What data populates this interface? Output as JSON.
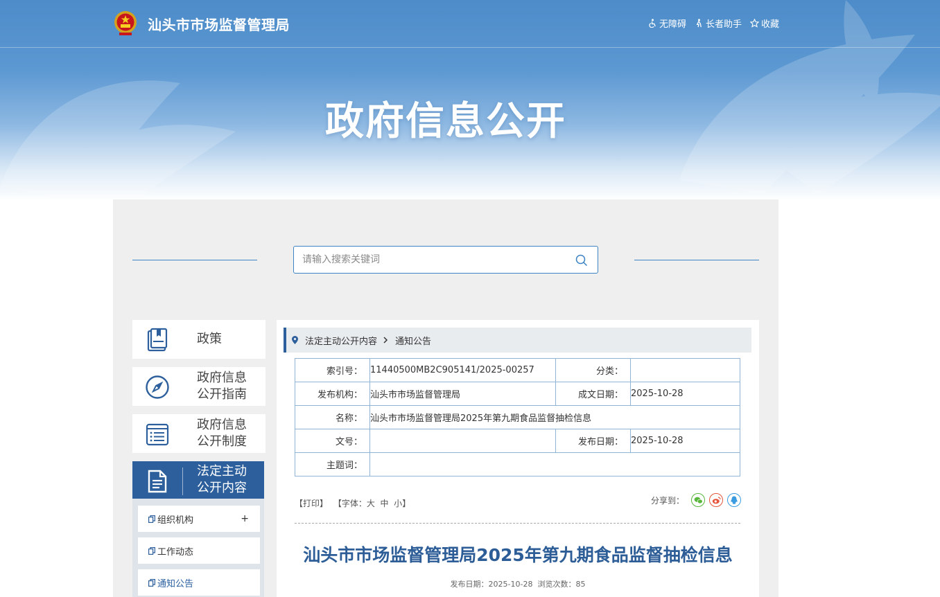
{
  "header": {
    "site_title": "汕头市市场监督管理局",
    "top_links": [
      {
        "label": "无障碍",
        "icon": "accessibility-icon"
      },
      {
        "label": "长者助手",
        "icon": "elder-assist-icon"
      },
      {
        "label": "收藏",
        "icon": "star-icon"
      }
    ],
    "hero_title": "政府信息公开"
  },
  "search": {
    "placeholder": "请输入搜索关键词"
  },
  "sidebar": {
    "items": [
      {
        "label": "政策",
        "icon": "book-icon"
      },
      {
        "label": "政府信息\n公开指南",
        "icon": "compass-icon"
      },
      {
        "label": "政府信息\n公开制度",
        "icon": "list-icon"
      },
      {
        "label": "法定主动\n公开内容",
        "icon": "document-icon",
        "active": true
      }
    ],
    "sub_items": [
      {
        "label": "组织机构",
        "expand": "+"
      },
      {
        "label": "工作动态"
      },
      {
        "label": "通知公告",
        "current": true
      }
    ]
  },
  "breadcrumb": {
    "parent": "法定主动公开内容",
    "current": "通知公告"
  },
  "meta_table": {
    "index_label": "索引号：",
    "index_value": "11440500MB2C905141/2025-00257",
    "category_label": "分类：",
    "category_value": "",
    "publisher_label": "发布机构：",
    "publisher_value": "汕头市市场监督管理局",
    "created_label": "成文日期：",
    "created_value": "2025-10-28",
    "name_label": "名称：",
    "name_value": "汕头市市场监督管理局2025年第九期食品监督抽检信息",
    "docno_label": "文号：",
    "docno_value": "",
    "published_label": "发布日期：",
    "published_value": "2025-10-28",
    "keywords_label": "主题词：",
    "keywords_value": ""
  },
  "tools": {
    "print": "【打印】",
    "font_prefix": "【字体：",
    "font_large": "大",
    "font_medium": "中",
    "font_small": "小",
    "font_suffix": "】",
    "share_label": "分享到："
  },
  "article": {
    "title": "汕头市市场监督管理局2025年第九期食品监督抽检信息",
    "meta": "发布日期：2025-10-28  浏览次数：85"
  },
  "colors": {
    "brand_blue": "#2c5f9c",
    "title_blue": "#2d5d97",
    "wechat": "#59b73b",
    "weibo": "#e5553b",
    "qq": "#3a9be0"
  }
}
